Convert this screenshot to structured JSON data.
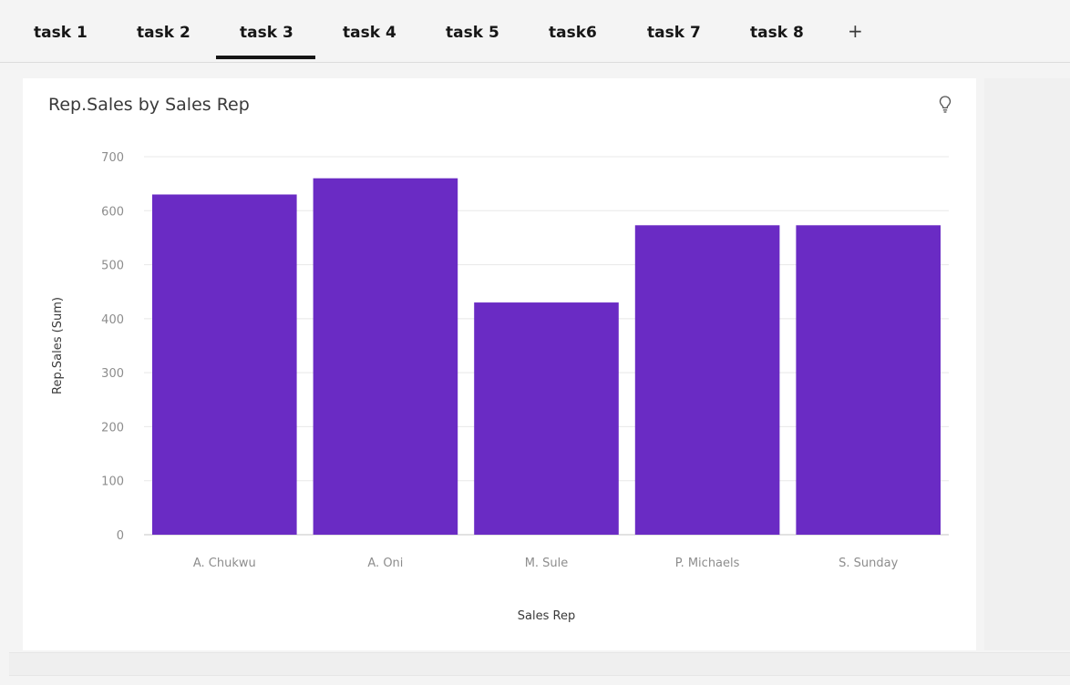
{
  "tabs": [
    {
      "label": "task 1",
      "active": false
    },
    {
      "label": "task 2",
      "active": false
    },
    {
      "label": "task 3",
      "active": true
    },
    {
      "label": "task 4",
      "active": false
    },
    {
      "label": "task 5",
      "active": false
    },
    {
      "label": "task6",
      "active": false
    },
    {
      "label": "task 7",
      "active": false
    },
    {
      "label": "task 8",
      "active": false
    }
  ],
  "add_tab_label": "+",
  "icons": {
    "add": "plus-icon",
    "insight": "lightbulb-icon"
  },
  "colors": {
    "bar": "#6a2bc4",
    "text": "#161616",
    "grid": "#e8e8e8",
    "axis_text": "#8d8d8d"
  },
  "chart_data": {
    "type": "bar",
    "title": "Rep.Sales by Sales Rep",
    "xlabel": "Sales Rep",
    "ylabel": "Rep.Sales (Sum)",
    "categories": [
      "A. Chukwu",
      "A. Oni",
      "M. Sule",
      "P. Michaels",
      "S. Sunday"
    ],
    "values": [
      630,
      660,
      430,
      573,
      573
    ],
    "ylim": [
      0,
      700
    ],
    "yticks": [
      0,
      100,
      200,
      300,
      400,
      500,
      600,
      700
    ],
    "grid": true
  }
}
